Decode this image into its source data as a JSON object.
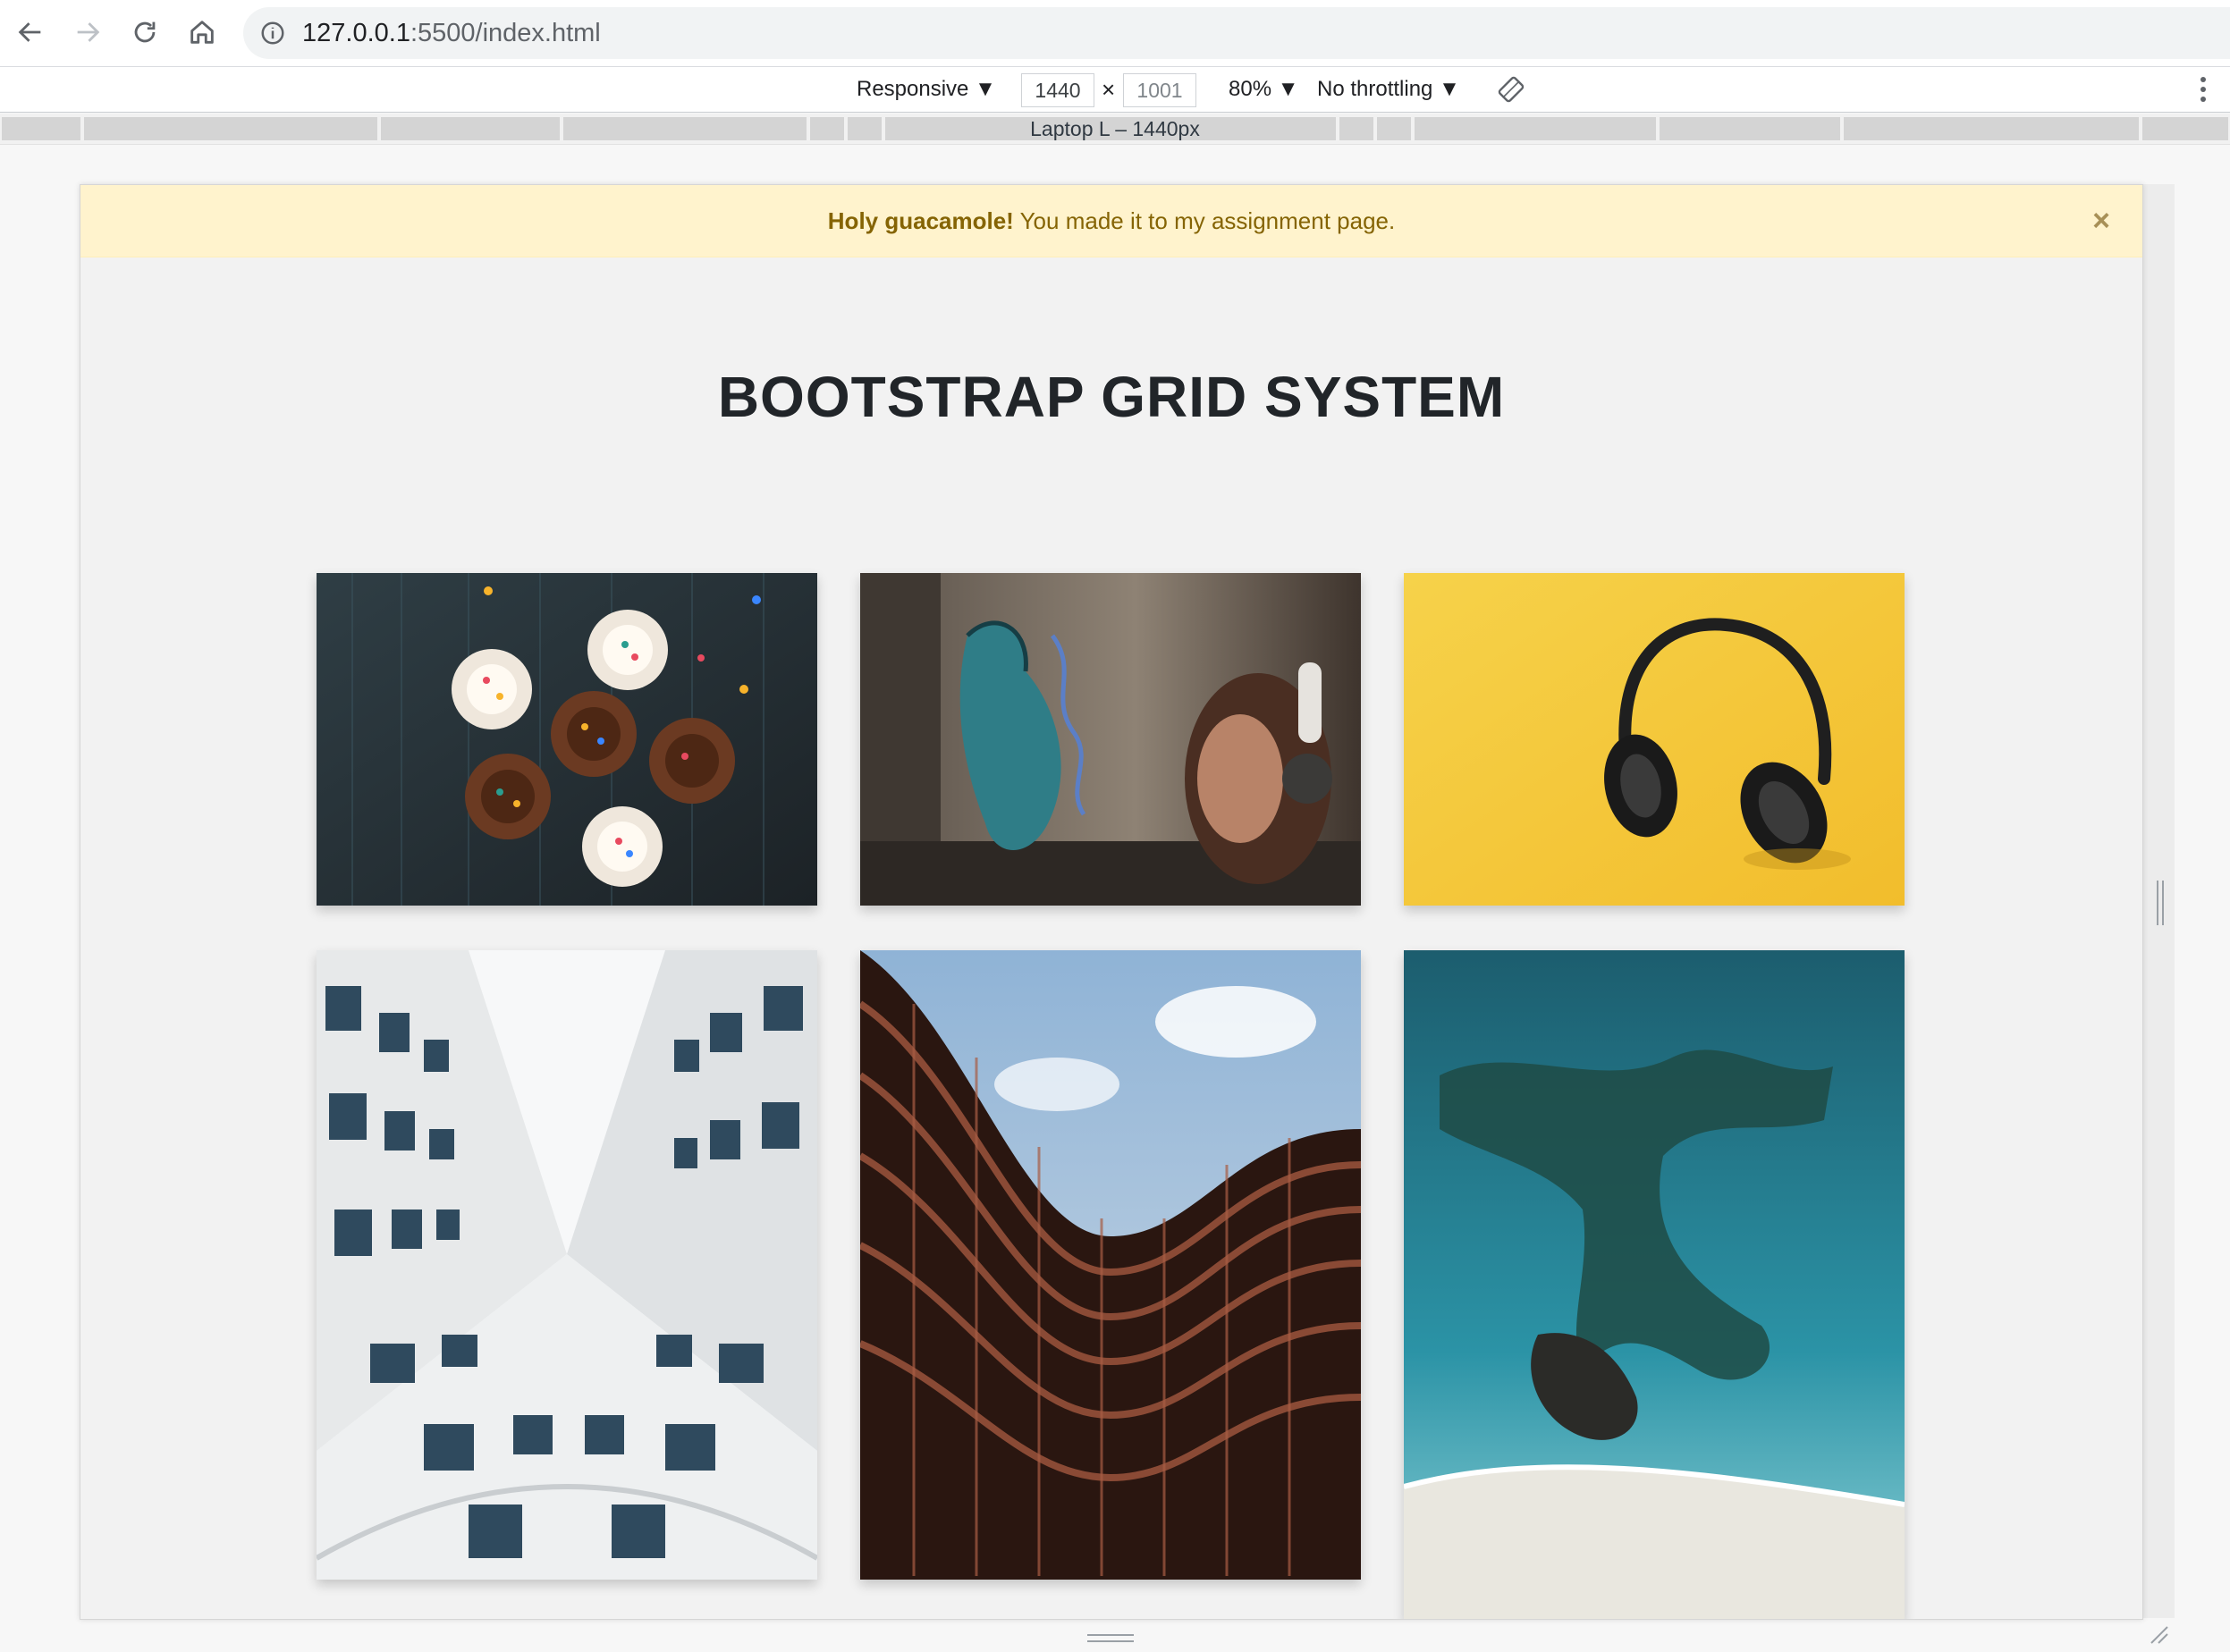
{
  "browser": {
    "url_host": "127.0.0.1",
    "url_path": ":5500/index.html"
  },
  "devtools": {
    "device": "Responsive",
    "width": "1440",
    "separator": "×",
    "height": "1001",
    "zoom": "80%",
    "throttling": "No throttling",
    "media_query_label": "Laptop L – 1440px"
  },
  "page": {
    "alert": {
      "strong": "Holy guacamole!",
      "text": " You made it to my assignment page.",
      "close": "×"
    },
    "heading": "BOOTSTRAP GRID SYSTEM",
    "images": [
      {
        "subject": "cupcakes with sprinkles on dark wood"
      },
      {
        "subject": "woman with headphones near graffiti wall"
      },
      {
        "subject": "black headphones on yellow background"
      },
      {
        "subject": "white building looking up at sky"
      },
      {
        "subject": "curved brown building against cloudy sky"
      },
      {
        "subject": "aerial view of turquoise sea and rocks"
      }
    ]
  },
  "colors": {
    "alert_bg": "#fff3cd",
    "alert_text": "#856404",
    "heading": "#212529",
    "page_bg": "#f2f2f2"
  }
}
